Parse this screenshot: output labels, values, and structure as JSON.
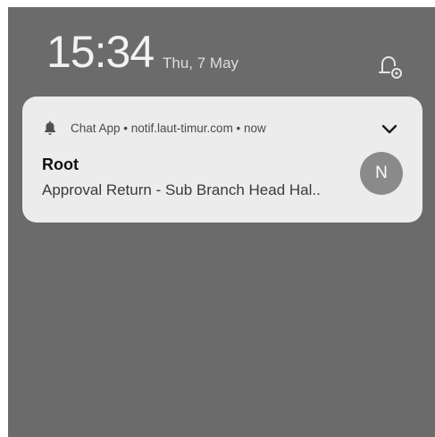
{
  "lockscreen": {
    "time": "15:34",
    "date": "Thu, 7 May",
    "status_icon": "notification-settings-icon"
  },
  "notification": {
    "app_icon": "bell-icon",
    "app_name": "Chat App",
    "source": "notif.laut-timur.com",
    "when": "now",
    "header_text": "Chat App • notif.laut-timur.com • now",
    "title": "Root",
    "body": "Approval Return - Sub Branch Head Hal..",
    "avatar_initial": "N",
    "expand_icon": "chevron-down-icon"
  },
  "colors": {
    "background": "#6b6b6b",
    "card": "#ececec",
    "avatar": "#8a8a8a"
  }
}
